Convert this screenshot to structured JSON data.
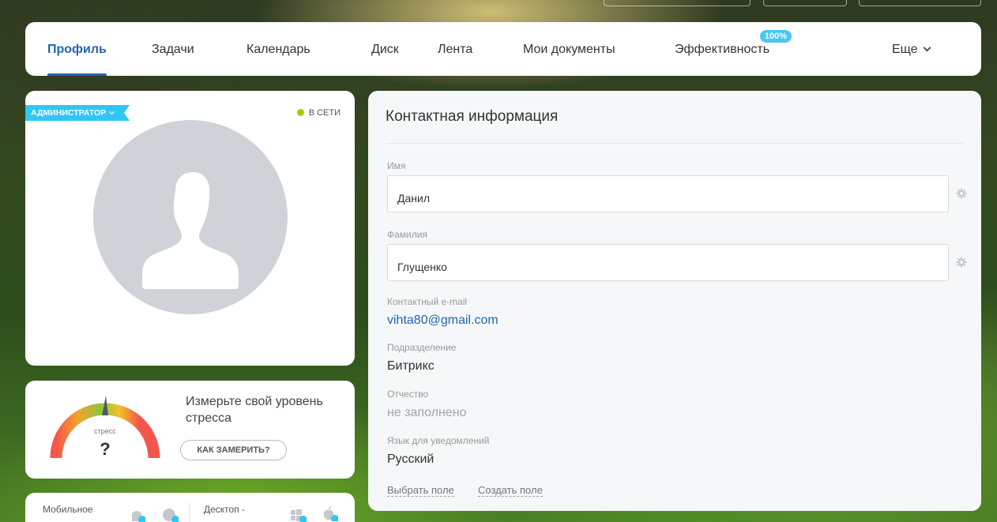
{
  "nav": {
    "tabs": [
      {
        "label": "Профиль",
        "active": true
      },
      {
        "label": "Задачи"
      },
      {
        "label": "Календарь"
      },
      {
        "label": "Диск"
      },
      {
        "label": "Лента"
      },
      {
        "label": "Мои документы"
      },
      {
        "label": "Эффективность",
        "badge": "100%"
      },
      {
        "label": "Еще"
      }
    ]
  },
  "profile": {
    "role": "АДМИНИСТРАТОР",
    "status": "В СЕТИ",
    "status_color": "#9dcf00"
  },
  "stress": {
    "gauge_label": "стресс",
    "gauge_value": "?",
    "text": "Измерьте свой уровень стресса",
    "button": "КАК ЗАМЕРИТЬ?"
  },
  "apps": {
    "mobile": "Мобильное",
    "desktop": "Десктоп -"
  },
  "contact": {
    "title": "Контактная информация",
    "first_name_label": "Имя",
    "first_name": "Данил",
    "last_name_label": "Фамилия",
    "last_name": "Глущенко",
    "email_label": "Контактный e-mail",
    "email": "vihta80@gmail.com",
    "department_label": "Подразделение",
    "department": "Битрикс",
    "patronymic_label": "Отчество",
    "patronymic": "не заполнено",
    "language_label": "Язык для уведомлений",
    "language": "Русский",
    "select_field": "Выбрать поле",
    "create_field": "Создать поле"
  },
  "colors": {
    "accent": "#2067b0",
    "tag": "#2fc6f6",
    "badge": "#47c7f4"
  }
}
